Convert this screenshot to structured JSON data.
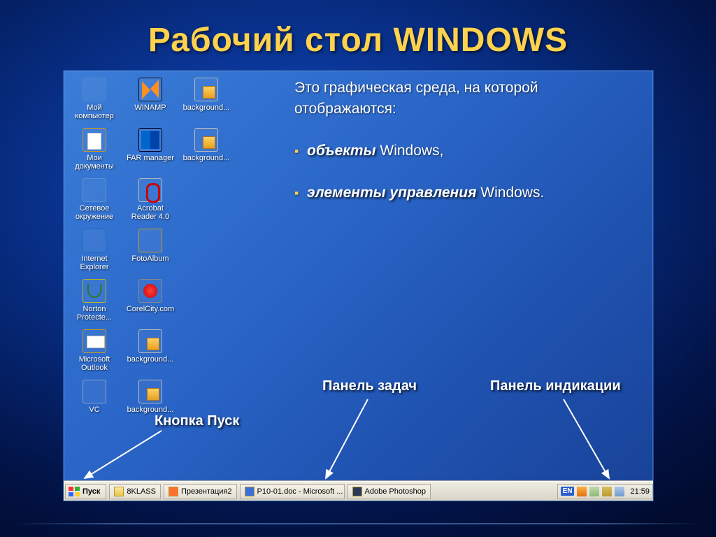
{
  "title": "Рабочий стол WINDOWS",
  "intro": "Это графическая среда, на которой отображаются:",
  "bullets": [
    {
      "bold": "объекты",
      "rest": " Windows,"
    },
    {
      "bold": "элементы управления",
      "rest": " Windows."
    }
  ],
  "annotations": {
    "start": "Кнопка Пуск",
    "taskbar": "Панель задач",
    "tray": "Панель индикации"
  },
  "icons": {
    "r0": [
      {
        "key": "my-computer",
        "label": "Мой компьютер",
        "cls": "ic-monitor"
      },
      {
        "key": "winamp",
        "label": "WINAMP",
        "cls": "ic-winamp"
      },
      {
        "key": "background1",
        "label": "background...",
        "cls": "ic-script"
      }
    ],
    "r1": [
      {
        "key": "my-documents",
        "label": "Мои документы",
        "cls": "ic-docs"
      },
      {
        "key": "far-manager",
        "label": "FAR manager",
        "cls": "ic-far"
      },
      {
        "key": "background2",
        "label": "background...",
        "cls": "ic-script"
      }
    ],
    "r2": [
      {
        "key": "network",
        "label": "Сетевое окружение",
        "cls": "ic-net"
      },
      {
        "key": "acrobat",
        "label": "Acrobat Reader 4.0",
        "cls": "ic-acrobat"
      }
    ],
    "r3": [
      {
        "key": "ie",
        "label": "Internet Explorer",
        "cls": "ic-ie"
      },
      {
        "key": "fotoalbum",
        "label": "FotoAlbum",
        "cls": "ic-folder"
      }
    ],
    "r4": [
      {
        "key": "norton",
        "label": "Norton Protecte...",
        "cls": "ic-shield"
      },
      {
        "key": "corelcity",
        "label": "CorelCity.com",
        "cls": "ic-corel"
      }
    ],
    "r5": [
      {
        "key": "outlook",
        "label": "Microsoft Outlook",
        "cls": "ic-outlook"
      },
      {
        "key": "background3",
        "label": "background...",
        "cls": "ic-script"
      }
    ],
    "r6": [
      {
        "key": "vc",
        "label": "VC",
        "cls": "ic-vc"
      },
      {
        "key": "background4",
        "label": "background...",
        "cls": "ic-script"
      }
    ]
  },
  "taskbar": {
    "start": "Пуск",
    "items": [
      {
        "key": "8klass",
        "label": "8KLASS",
        "cls": "t-folder"
      },
      {
        "key": "ppt",
        "label": "Презентация2",
        "cls": "t-ppt"
      },
      {
        "key": "word",
        "label": "P10-01.doc - Microsoft ...",
        "cls": "t-word"
      },
      {
        "key": "ps",
        "label": "Adobe Photoshop",
        "cls": "t-ps"
      }
    ],
    "lang": "EN",
    "clock": "21:59"
  }
}
